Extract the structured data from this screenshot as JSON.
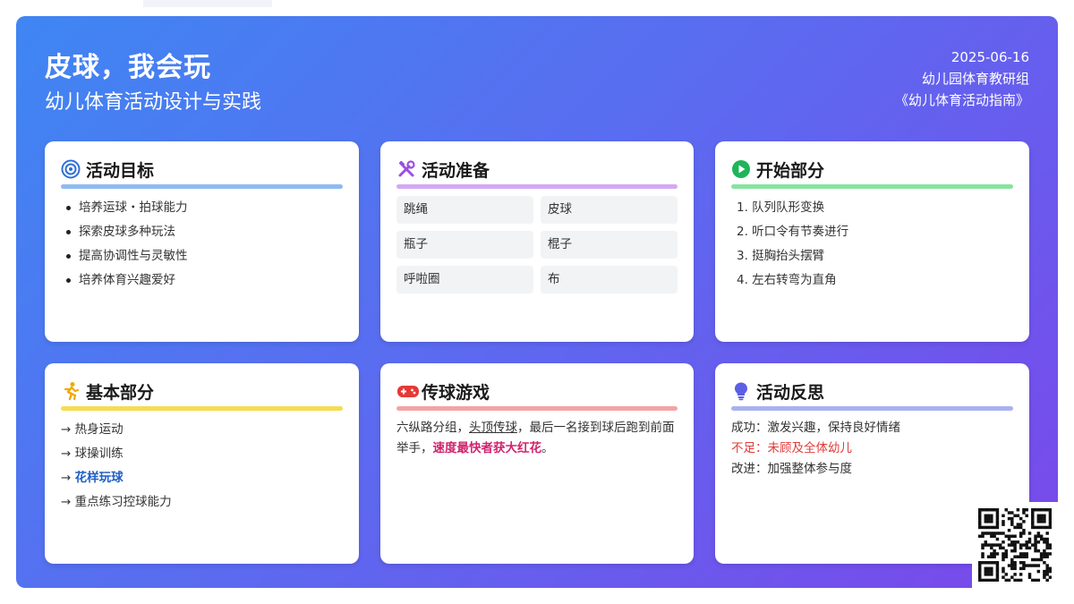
{
  "header": {
    "title": "皮球，我会玩",
    "subtitle": "幼儿体育活动设计与实践",
    "date": "2025-06-16",
    "author": "幼儿园体育教研组",
    "source": "《幼儿体育活动指南》"
  },
  "colors": {
    "gradient_start": "#3f86f3",
    "gradient_end": "#7a48ea",
    "accent_pink": "#d0246d",
    "accent_blue": "#1f5fc7",
    "warning_red": "#e03c3c"
  },
  "goals": {
    "icon": "target-icon",
    "title": "活动目标",
    "items": [
      "培养运球・拍球能力",
      "探索皮球多种玩法",
      "提高协调性与灵敏性",
      "培养体育兴趣爱好"
    ]
  },
  "prep": {
    "icon": "tools-icon",
    "title": "活动准备",
    "items": [
      "跳绳",
      "皮球",
      "瓶子",
      "棍子",
      "呼啦圈",
      "布"
    ]
  },
  "opening": {
    "icon": "play-icon",
    "title": "开始部分",
    "items": [
      "1. 队列队形变换",
      "2. 听口令有节奏进行",
      "3. 挺胸抬头摆臂",
      "4. 左右转弯为直角"
    ]
  },
  "basic": {
    "icon": "runner-icon",
    "title": "基本部分",
    "arrow": "→",
    "items": [
      "热身运动",
      "球操训练",
      "花样玩球",
      "重点练习控球能力"
    ]
  },
  "game": {
    "icon": "gamepad-icon",
    "title": "传球游戏",
    "text_1": "六纵路分组，",
    "text_underline": "头顶传球",
    "text_2": "，最后一名接到球后跑到前面举手，",
    "text_highlight": "速度最快者获大红花",
    "text_3": "。"
  },
  "reflection": {
    "icon": "lightbulb-icon",
    "title": "活动反思",
    "success": "成功：激发兴趣，保持良好情绪",
    "shortfall": "不足：未顾及全体幼儿",
    "improve": "改进：加强整体参与度"
  },
  "qr": {
    "icon": "qr-code-icon"
  }
}
